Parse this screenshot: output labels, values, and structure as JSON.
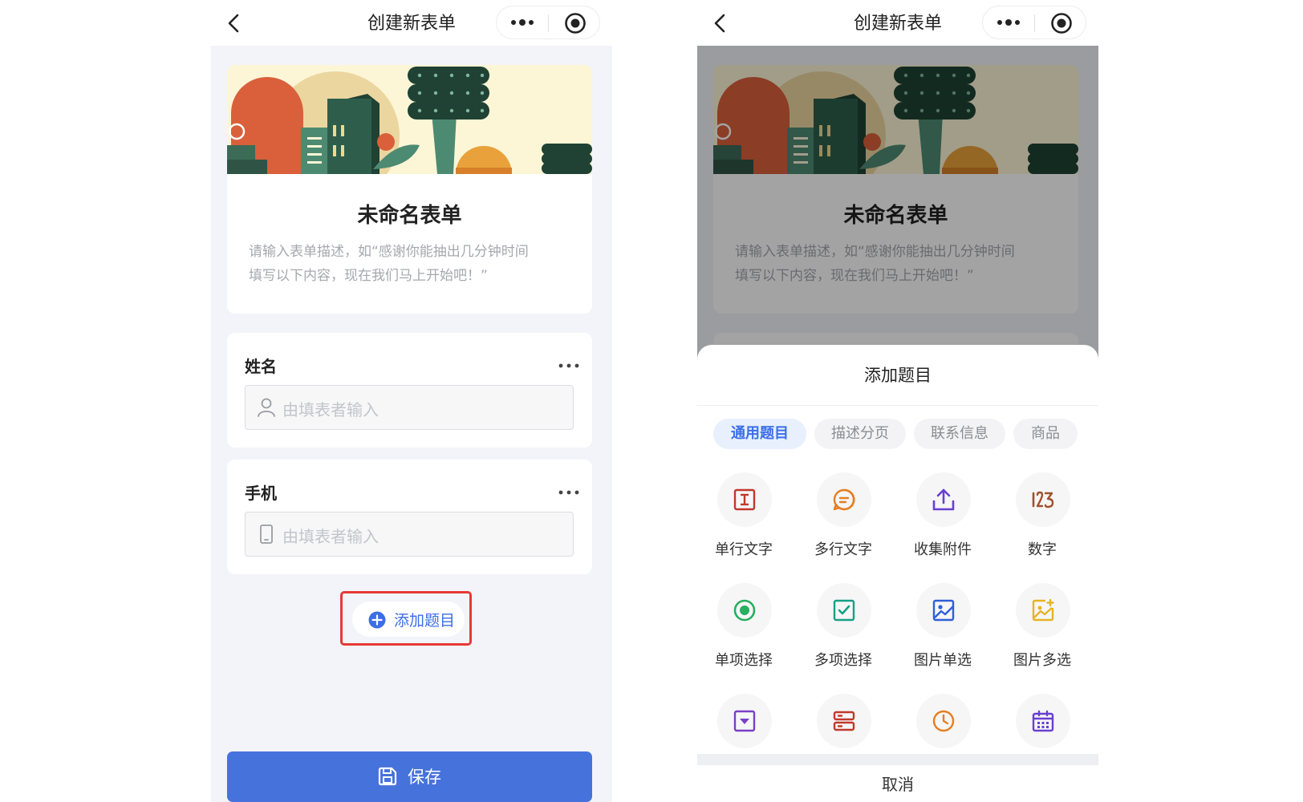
{
  "nav": {
    "title": "创建新表单"
  },
  "form": {
    "title": "未命名表单",
    "description_line1": "请输入表单描述，如“感谢你能抽出几分钟时间",
    "description_line2": "填写以下内容，现在我们马上开始吧！”"
  },
  "fields": [
    {
      "label": "姓名",
      "placeholder": "由填表者输入",
      "icon": "person-icon"
    },
    {
      "label": "手机",
      "placeholder": "由填表者输入",
      "icon": "phone-icon"
    }
  ],
  "add_question": {
    "label": "添加题目",
    "icon": "plus-circle-icon"
  },
  "save": {
    "label": "保存",
    "icon": "save-icon"
  },
  "sheet": {
    "title": "添加题目",
    "tabs": [
      {
        "label": "通用题目",
        "active": true
      },
      {
        "label": "描述分页",
        "active": false
      },
      {
        "label": "联系信息",
        "active": false
      },
      {
        "label": "商品",
        "active": false
      }
    ],
    "items": [
      {
        "label": "单行文字",
        "icon": "single-line-text-icon",
        "color": "#c0392b"
      },
      {
        "label": "多行文字",
        "icon": "multi-line-text-icon",
        "color": "#e67e22"
      },
      {
        "label": "收集附件",
        "icon": "upload-icon",
        "color": "#6a3fd1"
      },
      {
        "label": "数字",
        "icon": "number-icon",
        "color": "#a0522d"
      },
      {
        "label": "单项选择",
        "icon": "radio-icon",
        "color": "#27ae60"
      },
      {
        "label": "多项选择",
        "icon": "checkbox-icon",
        "color": "#16a085"
      },
      {
        "label": "图片单选",
        "icon": "image-single-icon",
        "color": "#2f5fd8"
      },
      {
        "label": "图片多选",
        "icon": "image-multi-icon",
        "color": "#e6b422"
      },
      {
        "label": "",
        "icon": "dropdown-icon",
        "color": "#7b3fc4"
      },
      {
        "label": "",
        "icon": "server-icon",
        "color": "#c0392b"
      },
      {
        "label": "",
        "icon": "clock-icon",
        "color": "#e67e22"
      },
      {
        "label": "",
        "icon": "calendar-icon",
        "color": "#6a3fd1"
      }
    ],
    "cancel_label": "取消"
  },
  "colors": {
    "primary": "#4672dc",
    "highlight": "#e53935",
    "background": "#f3f4f9"
  }
}
